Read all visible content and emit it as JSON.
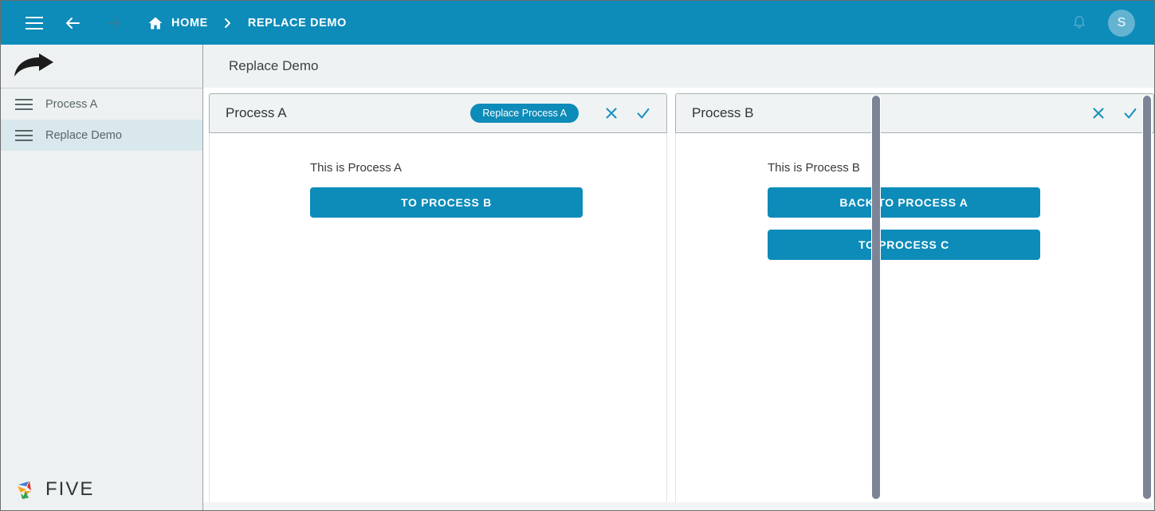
{
  "topbar": {
    "menu_icon": "hamburger-icon",
    "back_icon": "arrow-left-icon",
    "forward_icon": "arrow-right-icon",
    "home_icon": "home-icon",
    "home_label": "HOME",
    "separator_icon": "chevron-right-icon",
    "current_label": "REPLACE DEMO",
    "bell_icon": "bell-icon",
    "avatar_initial": "S",
    "background_color": "#0d8bb9"
  },
  "sidebar": {
    "logo_icon": "curved-arrow-icon",
    "items": [
      {
        "label": "Process A",
        "icon": "list-icon",
        "active": false
      },
      {
        "label": "Replace Demo",
        "icon": "list-icon",
        "active": true
      }
    ],
    "footer_logo_text": "FIVE",
    "footer_logo_icon": "five-pinwheel-icon"
  },
  "main": {
    "page_title": "Replace Demo",
    "panels": [
      {
        "title": "Process A",
        "badge_label": "Replace Process A",
        "close_icon": "close-icon",
        "confirm_icon": "check-icon",
        "content_label": "This is Process A",
        "buttons": [
          {
            "label": "TO PROCESS B"
          }
        ]
      },
      {
        "title": "Process B",
        "badge_label": null,
        "close_icon": "close-icon",
        "confirm_icon": "check-icon",
        "content_label": "This is Process B",
        "buttons": [
          {
            "label": "BACK TO PROCESS A"
          },
          {
            "label": "TO PROCESS C"
          }
        ]
      }
    ]
  },
  "colors": {
    "accent": "#0d8bb9",
    "sidebar_bg": "#edf1f2",
    "sidebar_active": "#d8e8ec",
    "panel_head_bg": "#eff3f4"
  }
}
